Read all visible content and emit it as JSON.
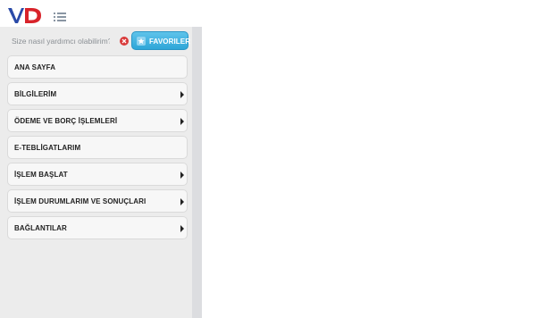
{
  "brand": {
    "logo": "vd-logo",
    "colors": {
      "v": "#2a4aa8",
      "d": "#d8232a"
    }
  },
  "header": {
    "menu_toggle_icon": "list-icon"
  },
  "search": {
    "placeholder": "Size nasıl yardımcı olabilirim?",
    "clear_icon": "clear-icon"
  },
  "favorites": {
    "label": "FAVORILER",
    "icon": "star-icon",
    "color": "#2ea6d8"
  },
  "menu": {
    "items": [
      {
        "label": "ANA SAYFA",
        "has_submenu": false
      },
      {
        "label": "BİLGİLERİM",
        "has_submenu": true
      },
      {
        "label": "ÖDEME VE BORÇ İŞLEMLERİ",
        "has_submenu": true
      },
      {
        "label": "E-TEBLİGATLARIM",
        "has_submenu": false
      },
      {
        "label": "İŞLEM BAŞLAT",
        "has_submenu": true
      },
      {
        "label": "İŞLEM DURUMLARIM VE SONUÇLARI",
        "has_submenu": true
      },
      {
        "label": "BAĞLANTILAR",
        "has_submenu": true
      }
    ]
  }
}
